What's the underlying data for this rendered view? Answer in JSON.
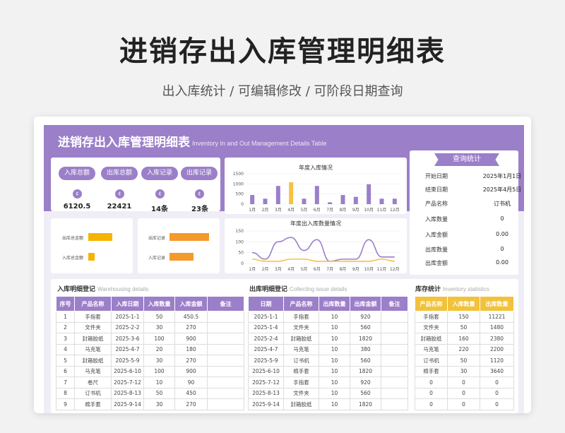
{
  "hero": {
    "title": "进销存出入库管理明细表",
    "subtitle": "出入库统计 /  可编辑修改  / 可阶段日期查询"
  },
  "sheet": {
    "title": "进销存出入库管理明细表",
    "title_en": "Inventory In and Out Management Details Table"
  },
  "kpis": [
    {
      "label": "入库总额",
      "icon": "coin-icon",
      "value": "6120.5"
    },
    {
      "label": "出库总额",
      "icon": "coin-icon",
      "value": "22421"
    },
    {
      "label": "入库记录",
      "icon": "coin-icon",
      "value": "14条"
    },
    {
      "label": "出库记录",
      "icon": "coin-icon",
      "value": "23条"
    }
  ],
  "mini_bars_left": {
    "rows": [
      {
        "label": "出库总金额",
        "value": 22421,
        "color": "#f5b400"
      },
      {
        "label": "入库总金额",
        "value": 6120.5,
        "color": "#f5b400"
      }
    ]
  },
  "mini_bars_right": {
    "rows": [
      {
        "label": "出库记录",
        "value": 23,
        "color": "#f39a2b"
      },
      {
        "label": "入库记录",
        "value": 14,
        "color": "#f39a2b"
      }
    ]
  },
  "chart_data": [
    {
      "type": "bar",
      "title": "年度入库情况",
      "categories": [
        "1月",
        "2月",
        "3月",
        "4月",
        "5月",
        "6月",
        "7月",
        "8月",
        "9月",
        "10月",
        "11月",
        "12月"
      ],
      "values": [
        450.5,
        270,
        900,
        1080,
        270,
        900,
        90,
        450,
        360,
        980,
        270,
        270
      ],
      "highlight_index": 3,
      "ylim": [
        0,
        1500
      ],
      "yticks": [
        0,
        500,
        1000,
        1500
      ],
      "colors": {
        "bar": "#9b7fc9",
        "highlight": "#f5c242"
      }
    },
    {
      "type": "line",
      "title": "年度出入库数量情况",
      "categories": [
        "1月",
        "2月",
        "3月",
        "4月",
        "5月",
        "6月",
        "7月",
        "8月",
        "9月",
        "10月",
        "11月",
        "12月"
      ],
      "series": [
        {
          "values": [
            50,
            20,
            100,
            120,
            60,
            110,
            10,
            20,
            20,
            110,
            30,
            30
          ],
          "color": "#9b7fc9"
        },
        {
          "values": [
            20,
            10,
            10,
            20,
            20,
            10,
            10,
            10,
            10,
            10,
            20,
            10
          ],
          "color": "#f5c242"
        }
      ],
      "ylim": [
        0,
        150
      ],
      "yticks": [
        0,
        50,
        100,
        150
      ]
    }
  ],
  "query": {
    "title": "查询统计",
    "rows": [
      {
        "label": "开始日期",
        "value": "2025年1月1日"
      },
      {
        "label": "结束日期",
        "value": "2025年4月5日"
      },
      {
        "label": "产品名称",
        "value": "订书机"
      },
      {
        "label": "入库数量",
        "value": "0"
      },
      {
        "label": "入库金额",
        "value": "0.00"
      },
      {
        "label": "出库数量",
        "value": "0"
      },
      {
        "label": "出库金额",
        "value": "0.00"
      }
    ]
  },
  "in_table": {
    "title": "入库明细登记",
    "title_en": "Warehousing details",
    "headers": [
      "序号",
      "产品名称",
      "入库日期",
      "入库数量",
      "入库金额",
      "备注"
    ],
    "rows": [
      [
        "1",
        "手指套",
        "2025-1-1",
        "50",
        "450.5",
        ""
      ],
      [
        "2",
        "文件夹",
        "2025-2-2",
        "30",
        "270",
        ""
      ],
      [
        "3",
        "封箱胶纸",
        "2025-3-6",
        "100",
        "900",
        ""
      ],
      [
        "4",
        "马克笔",
        "2025-4-7",
        "20",
        "180",
        ""
      ],
      [
        "5",
        "封箱胶纸",
        "2025-5-9",
        "30",
        "270",
        ""
      ],
      [
        "6",
        "马克笔",
        "2025-6-10",
        "100",
        "900",
        ""
      ],
      [
        "7",
        "卷尺",
        "2025-7-12",
        "10",
        "90",
        ""
      ],
      [
        "8",
        "订书机",
        "2025-8-13",
        "50",
        "450",
        ""
      ],
      [
        "9",
        "棉手套",
        "2025-9-14",
        "30",
        "270",
        ""
      ]
    ]
  },
  "out_table": {
    "title": "出库明细登记",
    "title_en": "Collecting issue details",
    "headers": [
      "日期",
      "产品名称",
      "出库数量",
      "出库金额",
      "备注"
    ],
    "rows": [
      [
        "2025-1-1",
        "手指套",
        "10",
        "920",
        ""
      ],
      [
        "2025-1-4",
        "文件夹",
        "10",
        "560",
        ""
      ],
      [
        "2025-2-4",
        "封箱胶纸",
        "10",
        "1820",
        ""
      ],
      [
        "2025-4-7",
        "马克笔",
        "10",
        "380",
        ""
      ],
      [
        "2025-5-9",
        "订书机",
        "10",
        "560",
        ""
      ],
      [
        "2025-6-10",
        "棉手套",
        "10",
        "1820",
        ""
      ],
      [
        "2025-7-12",
        "手指套",
        "10",
        "920",
        ""
      ],
      [
        "2025-8-13",
        "文件夹",
        "10",
        "560",
        ""
      ],
      [
        "2025-9-14",
        "封箱胶纸",
        "10",
        "1820",
        ""
      ]
    ]
  },
  "stock_table": {
    "title": "库存统计",
    "title_en": "Inventory statistics",
    "headers": [
      "产品名称",
      "入库数量",
      "出库数量"
    ],
    "rows": [
      [
        "手指套",
        "150",
        "11221"
      ],
      [
        "文件夹",
        "50",
        "1480"
      ],
      [
        "封箱胶纸",
        "160",
        "2380"
      ],
      [
        "马克笔",
        "220",
        "2200"
      ],
      [
        "订书机",
        "50",
        "1120"
      ],
      [
        "棉手套",
        "30",
        "3640"
      ],
      [
        "0",
        "0",
        "0"
      ],
      [
        "0",
        "0",
        "0"
      ],
      [
        "0",
        "0",
        "0"
      ]
    ]
  }
}
